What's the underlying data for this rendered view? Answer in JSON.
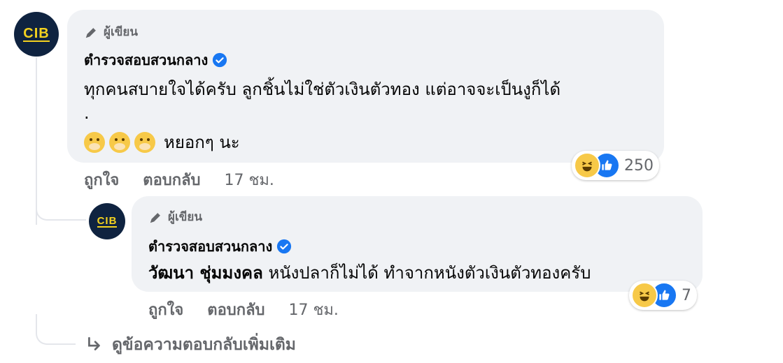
{
  "comment1": {
    "author_badge": "ผู้เขียน",
    "name": "ตำรวจสอบสวนกลาง",
    "text_line1": "ทุกคนสบายใจได้ครับ ลูกชิ้นไม่ใช่ตัวเงินตัวทอง แต่อาจจะเป็นงูก็ได้",
    "text_line2": ".",
    "text_line3": "หยอกๆ นะ",
    "reaction_count": "250",
    "like_label": "ถูกใจ",
    "reply_label": "ตอบกลับ",
    "time": "17 ชม."
  },
  "comment2": {
    "author_badge": "ผู้เขียน",
    "name": "ตำรวจสอบสวนกลาง",
    "mention": "วัฒนา ชุ่มมงคล",
    "text": "หนังปลาก็ไม่ได้ ทำจากหนังตัวเงินตัวทองครับ",
    "reaction_count": "7",
    "like_label": "ถูกใจ",
    "reply_label": "ตอบกลับ",
    "time": "17 ชม."
  },
  "more_replies": "ดูข้อความตอบกลับเพิ่มเติม",
  "avatar_text": "CIB",
  "colors": {
    "bubble": "#f0f2f5",
    "muted": "#65676b",
    "verified": "#1877f2",
    "like": "#1877f2",
    "haha": "#f7c948"
  }
}
